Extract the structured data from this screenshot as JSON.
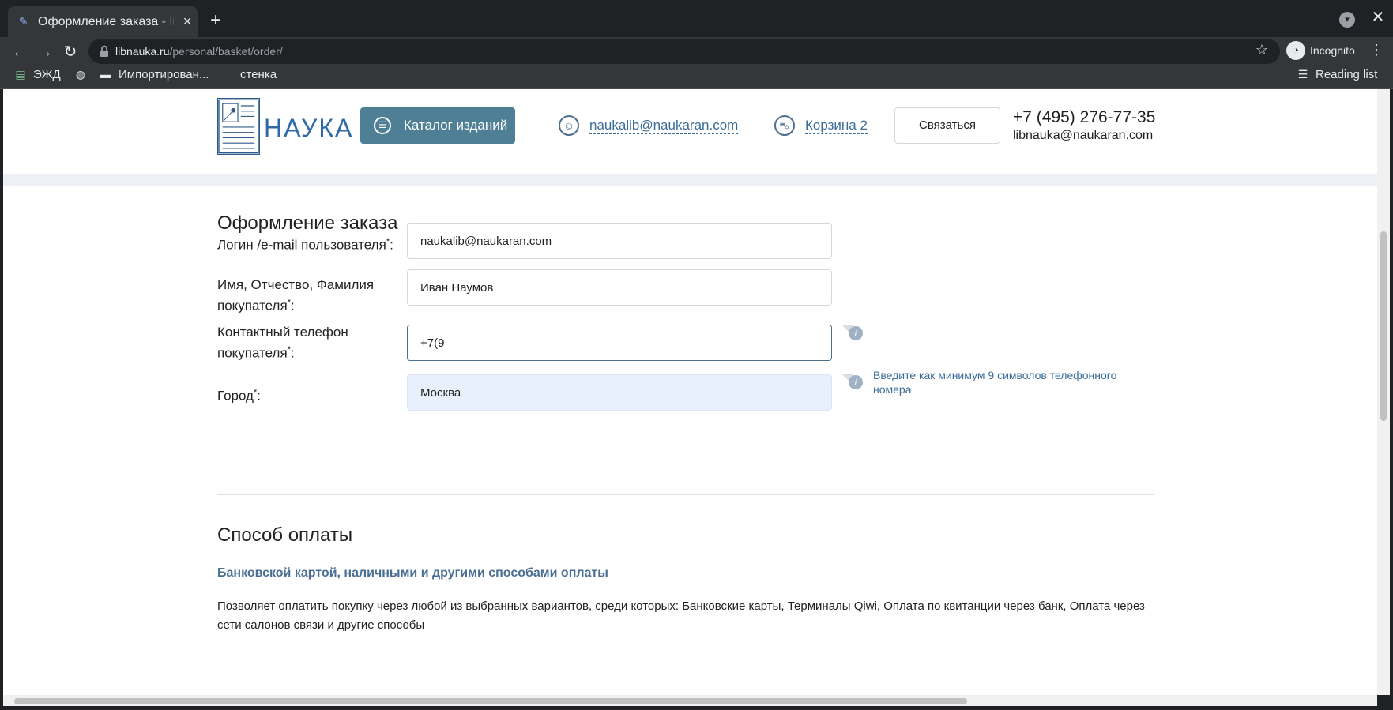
{
  "browser": {
    "tab_title": "Оформление заказа - libnauka.ru",
    "url_domain": "libnauka.ru",
    "url_path": "/personal/basket/order/",
    "incognito_label": "Incognito",
    "bookmarks": [
      "ЭЖД",
      "Импортирован...",
      "стенка"
    ],
    "reading_list": "Reading list"
  },
  "header": {
    "logo_text": "НАУКА",
    "catalog_button": "Каталог изданий",
    "user_email": "naukalib@naukaran.com",
    "cart_label": "Корзина 2",
    "contact_button": "Связаться",
    "phone": "+7 (495) 276-77-35",
    "email": "libnauka@naukaran.com"
  },
  "order": {
    "title": "Оформление заказа",
    "fields": {
      "login": {
        "label": "Логин /e-mail пользователя",
        "value": "naukalib@naukaran.com"
      },
      "fio": {
        "label_line1": "Имя, Отчество, Фамилия",
        "label_line2": "покупателя",
        "value": "Иван Наумов"
      },
      "phone": {
        "label_line1": "Контактный телефон",
        "label_line2": "покупателя",
        "value": "+7(9"
      },
      "city": {
        "label": "Город",
        "value": "Москва"
      }
    },
    "required_mark": "*",
    "colon": ":",
    "phone_hint": "Введите как минимум 9 символов телефонного номера"
  },
  "payment": {
    "title": "Способ оплаты",
    "option_title": "Банковской картой, наличными и другими способами оплаты",
    "option_desc": "Позволяет оплатить покупку через любой из выбранных вариантов, среди которых: Банковские карты, Терминалы Qiwi, Оплата по квитанции через банк, Оплата через сети салонов связи и другие способы"
  },
  "colors": {
    "accent": "#4e7f94",
    "link": "#3b6c98",
    "browser_dark": "#202124"
  }
}
